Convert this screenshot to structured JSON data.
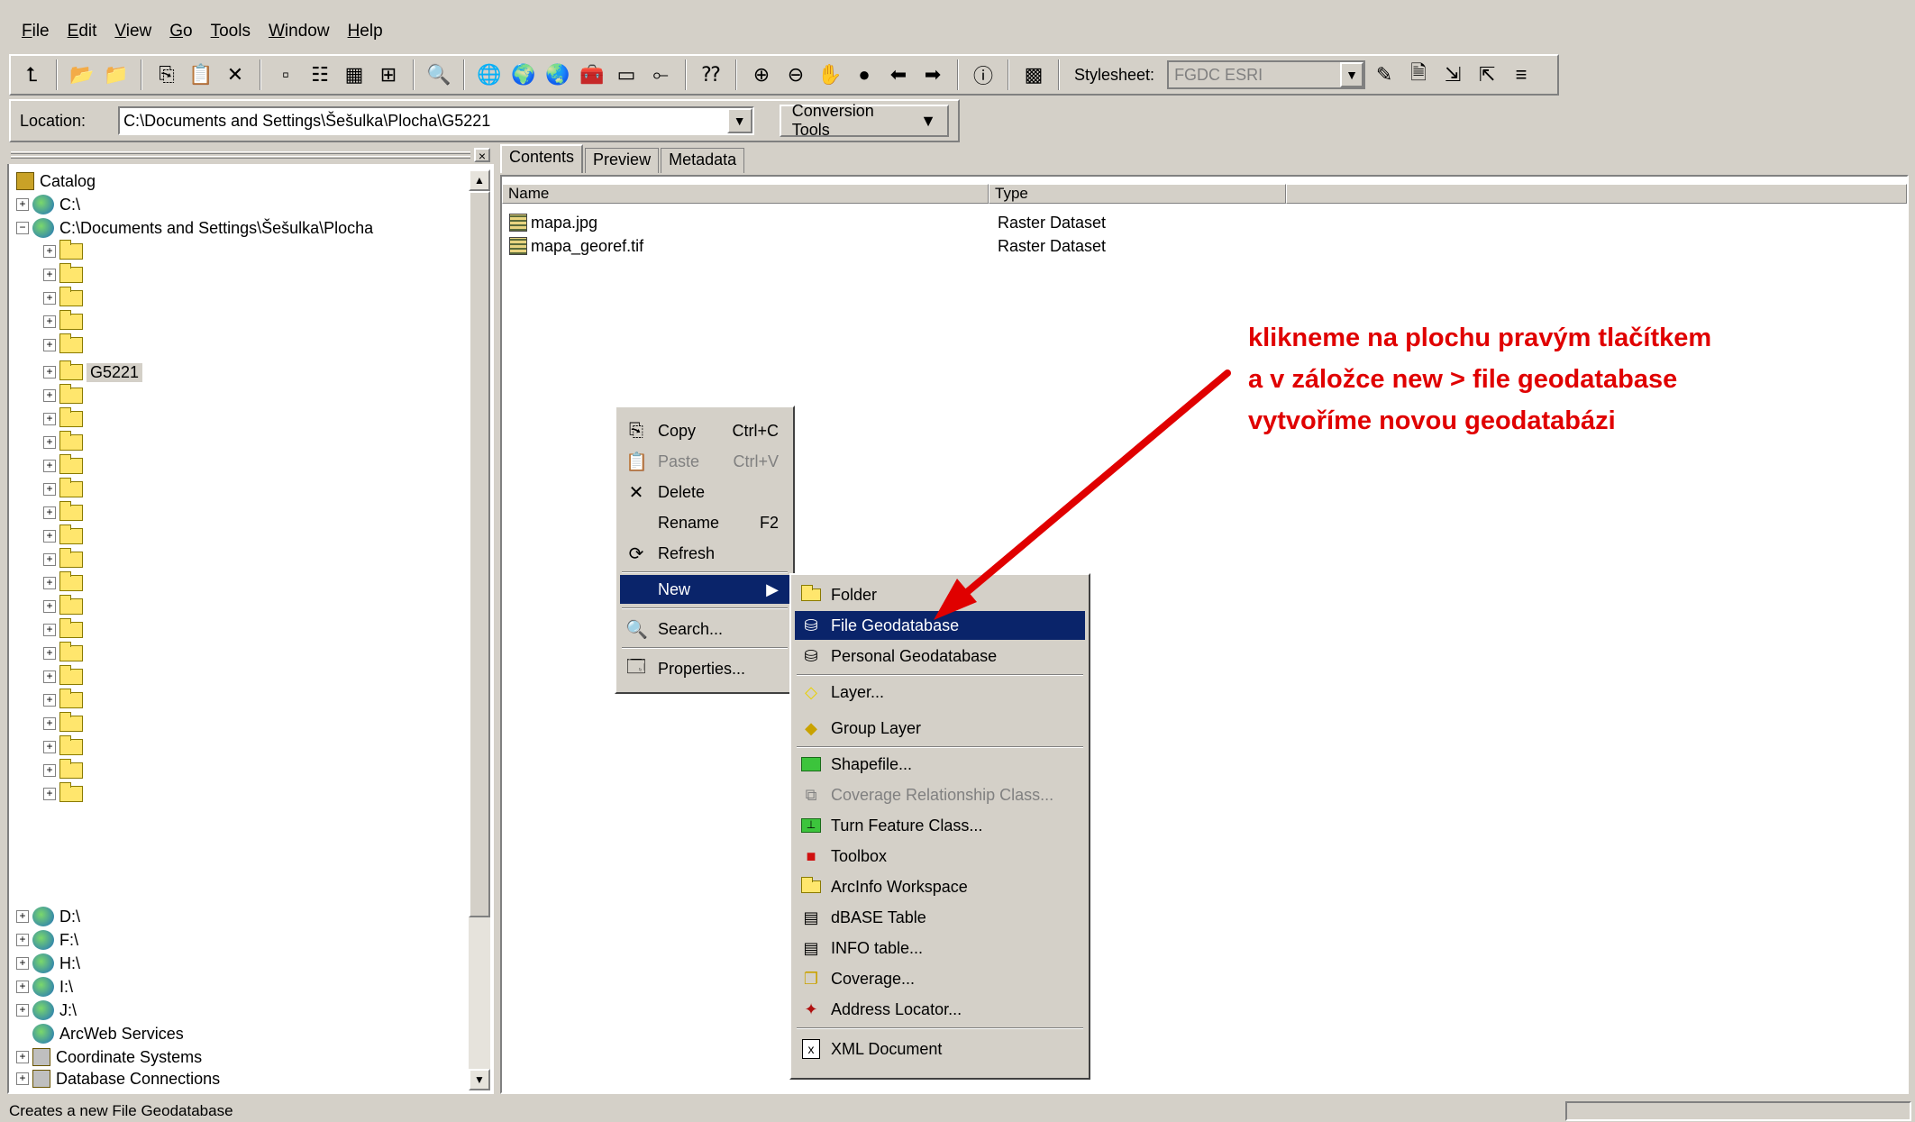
{
  "menubar": {
    "items": [
      "File",
      "Edit",
      "View",
      "Go",
      "Tools",
      "Window",
      "Help"
    ]
  },
  "toolbar": {
    "stylesheet_label": "Stylesheet:",
    "stylesheet_value": "FGDC ESRI"
  },
  "location": {
    "label": "Location:",
    "value": "C:\\Documents and Settings\\Šešulka\\Plocha\\G5221",
    "conversion_tools": "Conversion Tools"
  },
  "tree": {
    "root": "Catalog",
    "drive_c": "C:\\",
    "plocha": "C:\\Documents and Settings\\Šešulka\\Plocha",
    "selected_folder": "G5221",
    "drive_d": "D:\\",
    "drive_f": "F:\\",
    "drive_h": "H:\\",
    "drive_i": "I:\\",
    "drive_j": "J:\\",
    "arcweb": "ArcWeb Services",
    "coord": "Coordinate Systems",
    "dbconn": "Database Connections"
  },
  "tabs": [
    "Contents",
    "Preview",
    "Metadata"
  ],
  "contents": {
    "columns": [
      "Name",
      "Type"
    ],
    "rows": [
      {
        "name": "mapa.jpg",
        "type": "Raster Dataset"
      },
      {
        "name": "mapa_georef.tif",
        "type": "Raster Dataset"
      }
    ]
  },
  "context_menu": {
    "copy": "Copy",
    "copy_sc": "Ctrl+C",
    "paste": "Paste",
    "paste_sc": "Ctrl+V",
    "delete": "Delete",
    "rename": "Rename",
    "rename_sc": "F2",
    "refresh": "Refresh",
    "new": "New",
    "search": "Search...",
    "properties": "Properties..."
  },
  "submenu": {
    "folder": "Folder",
    "file_gdb": "File Geodatabase",
    "personal_gdb": "Personal Geodatabase",
    "layer": "Layer...",
    "group_layer": "Group Layer",
    "shapefile": "Shapefile...",
    "coverage_rel": "Coverage Relationship Class...",
    "turn_feature": "Turn Feature Class...",
    "toolbox": "Toolbox",
    "arcinfo_ws": "ArcInfo Workspace",
    "dbase": "dBASE Table",
    "info_table": "INFO table...",
    "coverage": "Coverage...",
    "address_locator": "Address Locator...",
    "xml": "XML Document"
  },
  "annotation": {
    "line1": "klikneme na plochu pravým tlačítkem",
    "line2": "a v záložce new > file geodatabase",
    "line3": "vytvoříme novou geodatabázi",
    "color": "#e00000"
  },
  "status": {
    "text": "Creates a new File Geodatabase"
  },
  "colors": {
    "highlight": "#0a246a",
    "face": "#d4d0c8"
  }
}
